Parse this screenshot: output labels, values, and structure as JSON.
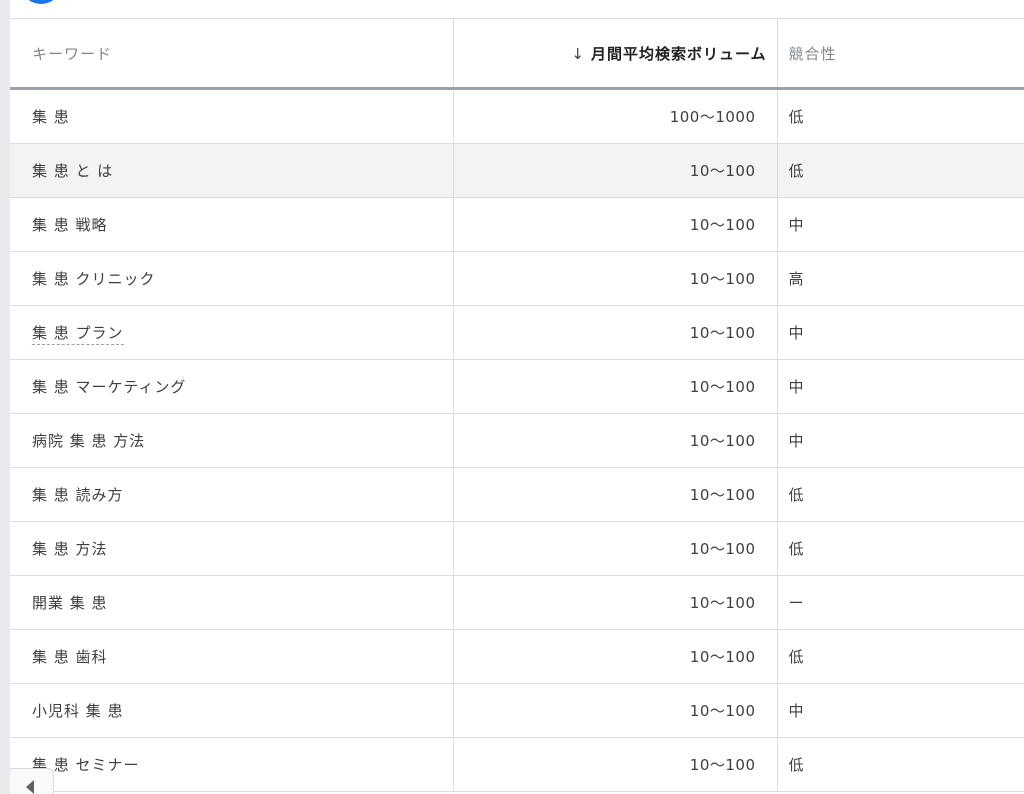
{
  "table": {
    "headers": {
      "keyword": "キーワード",
      "volume": "月間平均検索ボリューム",
      "competition": "競合性"
    },
    "sort_arrow": "↓",
    "rows": [
      {
        "keyword": "集 患",
        "volume": "100〜1000",
        "competition": "低"
      },
      {
        "keyword": "集 患 と は",
        "volume": "10〜100",
        "competition": "低"
      },
      {
        "keyword": "集 患 戦略",
        "volume": "10〜100",
        "competition": "中"
      },
      {
        "keyword": "集 患 クリニック",
        "volume": "10〜100",
        "competition": "高"
      },
      {
        "keyword": "集 患 プラン",
        "volume": "10〜100",
        "competition": "中"
      },
      {
        "keyword": "集 患 マーケティング",
        "volume": "10〜100",
        "competition": "中"
      },
      {
        "keyword": "病院 集 患 方法",
        "volume": "10〜100",
        "competition": "中"
      },
      {
        "keyword": "集 患 読み方",
        "volume": "10〜100",
        "competition": "低"
      },
      {
        "keyword": "集 患 方法",
        "volume": "10〜100",
        "competition": "低"
      },
      {
        "keyword": "開業 集 患",
        "volume": "10〜100",
        "competition": "ー"
      },
      {
        "keyword": "集 患 歯科",
        "volume": "10〜100",
        "competition": "低"
      },
      {
        "keyword": "小児科 集 患",
        "volume": "10〜100",
        "competition": "中"
      },
      {
        "keyword": "集 患 セミナー",
        "volume": "10〜100",
        "competition": "低"
      }
    ]
  },
  "icons": {
    "fab": "add-icon",
    "scroll_left": "chevron-left-icon"
  },
  "colors": {
    "accent": "#1a73e8",
    "hover_row": "#f1f3f4"
  }
}
